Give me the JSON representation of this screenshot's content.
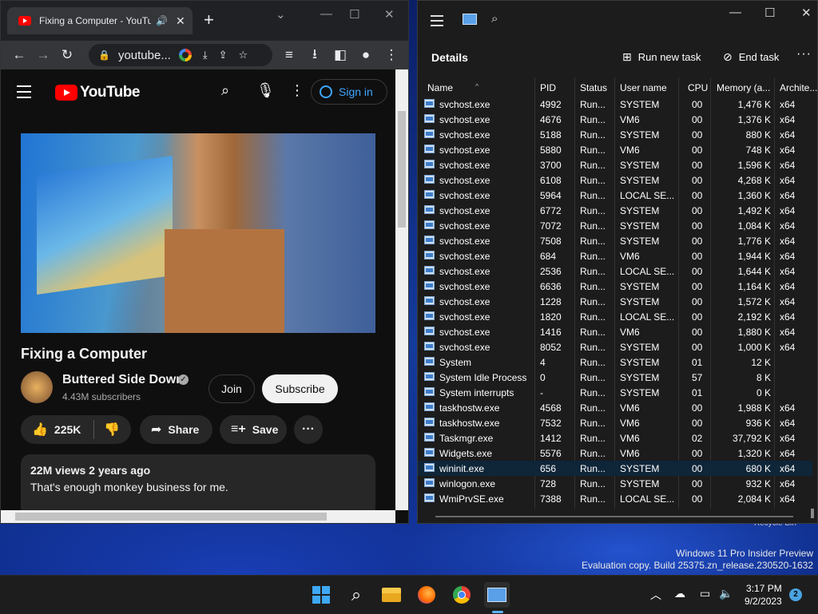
{
  "desktop": {
    "watermark_line1": "Windows 11 Pro Insider Preview",
    "watermark_line2": "Evaluation copy. Build 25375.zn_release.230520-1632",
    "recycle_bin": "Recycle Bin"
  },
  "chrome": {
    "tab_title": "Fixing a Computer - YouTube",
    "address": "youtube...",
    "youtube": {
      "logo_text": "YouTube",
      "signin_label": "Sign in",
      "video_title": "Fixing a Computer",
      "channel_name": "Buttered Side Down",
      "subscribers": "4.43M subscribers",
      "join_label": "Join",
      "subscribe_label": "Subscribe",
      "likes": "225K",
      "share_label": "Share",
      "save_label": "Save",
      "views": "22M views  2 years ago",
      "description": "That's enough monkey business for me."
    }
  },
  "taskmgr": {
    "page_heading": "Details",
    "run_new_task": "Run new task",
    "end_task": "End task",
    "columns": [
      "Name",
      "PID",
      "Status",
      "User name",
      "CPU",
      "Memory (a...",
      "Archite..."
    ],
    "rows": [
      {
        "name": "svchost.exe",
        "pid": "4992",
        "status": "Run...",
        "user": "SYSTEM",
        "cpu": "00",
        "mem": "1,476 K",
        "arch": "x64"
      },
      {
        "name": "svchost.exe",
        "pid": "4676",
        "status": "Run...",
        "user": "VM6",
        "cpu": "00",
        "mem": "1,376 K",
        "arch": "x64"
      },
      {
        "name": "svchost.exe",
        "pid": "5188",
        "status": "Run...",
        "user": "SYSTEM",
        "cpu": "00",
        "mem": "880 K",
        "arch": "x64"
      },
      {
        "name": "svchost.exe",
        "pid": "5880",
        "status": "Run...",
        "user": "VM6",
        "cpu": "00",
        "mem": "748 K",
        "arch": "x64"
      },
      {
        "name": "svchost.exe",
        "pid": "3700",
        "status": "Run...",
        "user": "SYSTEM",
        "cpu": "00",
        "mem": "1,596 K",
        "arch": "x64"
      },
      {
        "name": "svchost.exe",
        "pid": "6108",
        "status": "Run...",
        "user": "SYSTEM",
        "cpu": "00",
        "mem": "4,268 K",
        "arch": "x64"
      },
      {
        "name": "svchost.exe",
        "pid": "5964",
        "status": "Run...",
        "user": "LOCAL SE...",
        "cpu": "00",
        "mem": "1,360 K",
        "arch": "x64"
      },
      {
        "name": "svchost.exe",
        "pid": "6772",
        "status": "Run...",
        "user": "SYSTEM",
        "cpu": "00",
        "mem": "1,492 K",
        "arch": "x64"
      },
      {
        "name": "svchost.exe",
        "pid": "7072",
        "status": "Run...",
        "user": "SYSTEM",
        "cpu": "00",
        "mem": "1,084 K",
        "arch": "x64"
      },
      {
        "name": "svchost.exe",
        "pid": "7508",
        "status": "Run...",
        "user": "SYSTEM",
        "cpu": "00",
        "mem": "1,776 K",
        "arch": "x64"
      },
      {
        "name": "svchost.exe",
        "pid": "684",
        "status": "Run...",
        "user": "VM6",
        "cpu": "00",
        "mem": "1,944 K",
        "arch": "x64"
      },
      {
        "name": "svchost.exe",
        "pid": "2536",
        "status": "Run...",
        "user": "LOCAL SE...",
        "cpu": "00",
        "mem": "1,644 K",
        "arch": "x64"
      },
      {
        "name": "svchost.exe",
        "pid": "6636",
        "status": "Run...",
        "user": "SYSTEM",
        "cpu": "00",
        "mem": "1,164 K",
        "arch": "x64"
      },
      {
        "name": "svchost.exe",
        "pid": "1228",
        "status": "Run...",
        "user": "SYSTEM",
        "cpu": "00",
        "mem": "1,572 K",
        "arch": "x64"
      },
      {
        "name": "svchost.exe",
        "pid": "1820",
        "status": "Run...",
        "user": "LOCAL SE...",
        "cpu": "00",
        "mem": "2,192 K",
        "arch": "x64"
      },
      {
        "name": "svchost.exe",
        "pid": "1416",
        "status": "Run...",
        "user": "VM6",
        "cpu": "00",
        "mem": "1,880 K",
        "arch": "x64"
      },
      {
        "name": "svchost.exe",
        "pid": "8052",
        "status": "Run...",
        "user": "SYSTEM",
        "cpu": "00",
        "mem": "1,000 K",
        "arch": "x64"
      },
      {
        "name": "System",
        "pid": "4",
        "status": "Run...",
        "user": "SYSTEM",
        "cpu": "01",
        "mem": "12 K",
        "arch": ""
      },
      {
        "name": "System Idle Process",
        "pid": "0",
        "status": "Run...",
        "user": "SYSTEM",
        "cpu": "57",
        "mem": "8 K",
        "arch": ""
      },
      {
        "name": "System interrupts",
        "pid": "-",
        "status": "Run...",
        "user": "SYSTEM",
        "cpu": "01",
        "mem": "0 K",
        "arch": ""
      },
      {
        "name": "taskhostw.exe",
        "pid": "4568",
        "status": "Run...",
        "user": "VM6",
        "cpu": "00",
        "mem": "1,988 K",
        "arch": "x64"
      },
      {
        "name": "taskhostw.exe",
        "pid": "7532",
        "status": "Run...",
        "user": "VM6",
        "cpu": "00",
        "mem": "936 K",
        "arch": "x64"
      },
      {
        "name": "Taskmgr.exe",
        "pid": "1412",
        "status": "Run...",
        "user": "VM6",
        "cpu": "02",
        "mem": "37,792 K",
        "arch": "x64"
      },
      {
        "name": "Widgets.exe",
        "pid": "5576",
        "status": "Run...",
        "user": "VM6",
        "cpu": "00",
        "mem": "1,320 K",
        "arch": "x64"
      },
      {
        "name": "wininit.exe",
        "pid": "656",
        "status": "Run...",
        "user": "SYSTEM",
        "cpu": "00",
        "mem": "680 K",
        "arch": "x64",
        "selected": true
      },
      {
        "name": "winlogon.exe",
        "pid": "728",
        "status": "Run...",
        "user": "SYSTEM",
        "cpu": "00",
        "mem": "932 K",
        "arch": "x64"
      },
      {
        "name": "WmiPrvSE.exe",
        "pid": "7388",
        "status": "Run...",
        "user": "LOCAL SE...",
        "cpu": "00",
        "mem": "2,084 K",
        "arch": "x64"
      }
    ]
  },
  "taskbar": {
    "time": "3:17 PM",
    "date": "9/2/2023",
    "notification_count": "2",
    "accent_color": "#3fa8f4"
  }
}
